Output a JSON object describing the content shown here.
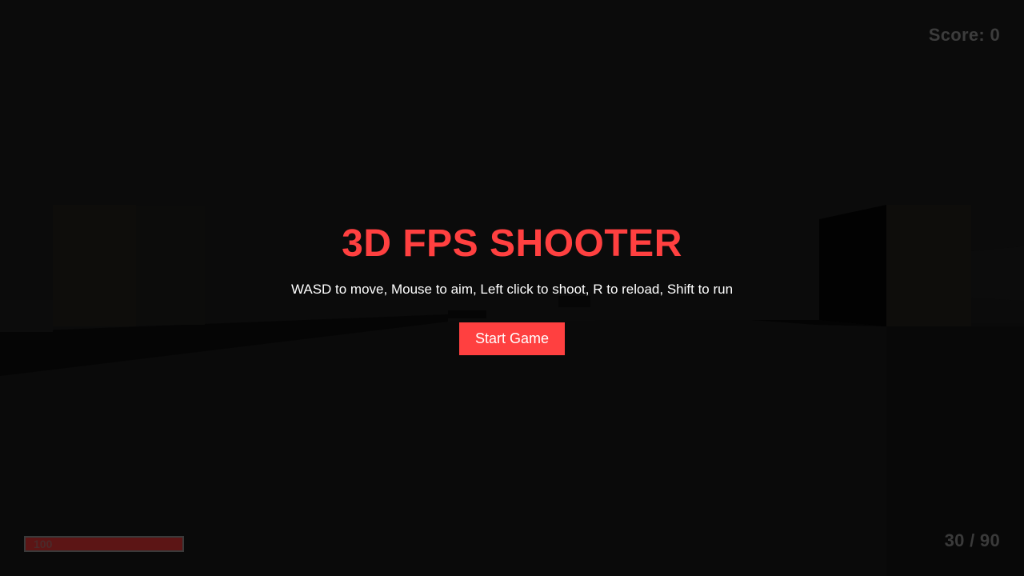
{
  "hud": {
    "score_text": "Score: 0",
    "ammo_text": "30 / 90",
    "health_text": "100",
    "health_fraction": 1.0
  },
  "menu": {
    "title": "3D FPS SHOOTER",
    "instructions": "WASD to move, Mouse to aim, Left click to shoot, R to reload, Shift to run",
    "start_label": "Start Game"
  },
  "colors": {
    "accent": "#ff4040",
    "background": "#0a0a0a",
    "hud_text": "#3c3c3c",
    "health_fill": "#5c1515"
  }
}
